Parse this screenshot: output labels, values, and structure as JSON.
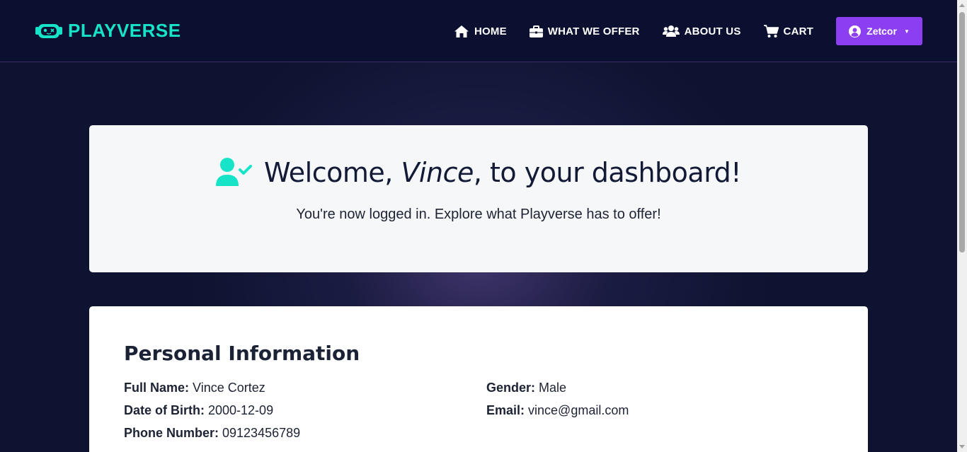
{
  "brand": {
    "name": "PLAYVERSE",
    "icon": "robot-icon",
    "color": "#16e3c8"
  },
  "nav": {
    "items": [
      {
        "label": "HOME",
        "icon": "home-icon"
      },
      {
        "label": "WHAT WE OFFER",
        "icon": "briefcase-icon"
      },
      {
        "label": "ABOUT US",
        "icon": "users-icon"
      },
      {
        "label": "CART",
        "icon": "cart-icon"
      }
    ],
    "user": {
      "label": "Zetcor",
      "icon": "user-circle-icon",
      "color": "#8c3ff0"
    }
  },
  "welcome": {
    "icon": "user-check-icon",
    "prefix": "Welcome, ",
    "name": "Vince",
    "suffix": ", to your dashboard!",
    "subtitle": "You're now logged in. Explore what Playverse has to offer!"
  },
  "personal_info": {
    "title": "Personal Information",
    "fields": [
      {
        "label": "Full Name:",
        "value": " Vince Cortez"
      },
      {
        "label": "Date of Birth:",
        "value": " 2000-12-09"
      },
      {
        "label": "Phone Number:",
        "value": " 09123456789"
      },
      {
        "label": "Gender:",
        "value": " Male"
      },
      {
        "label": "Email:",
        "value": " vince@gmail.com"
      }
    ]
  }
}
